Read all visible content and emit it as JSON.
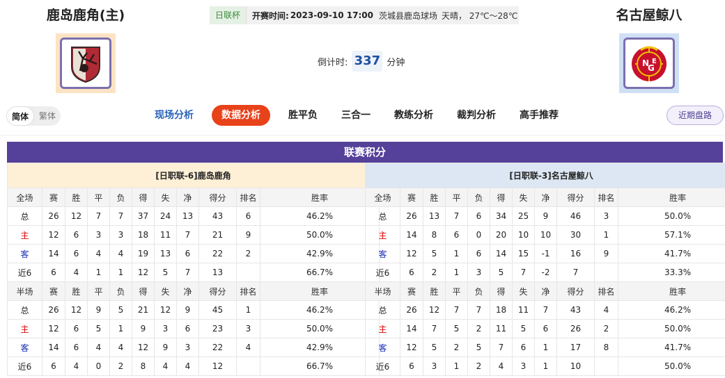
{
  "home": {
    "name": "鹿岛鹿角(主)",
    "logo_bg": "#fce3c4"
  },
  "away": {
    "name": "名古屋鲸八",
    "logo_bg": "#cfe0f5"
  },
  "match": {
    "league": "日联杯",
    "kickoff_label": "开赛时间:",
    "kickoff_time": "2023-09-10 17:00",
    "venue": "茨城县鹿岛球场",
    "weather": "天晴， 27℃～28℃"
  },
  "countdown": {
    "label": "倒计时:",
    "value": "337",
    "unit": "分钟"
  },
  "lang": {
    "simplified": "简体",
    "traditional": "繁体"
  },
  "nav": [
    "现场分析",
    "数据分析",
    "胜平负",
    "三合一",
    "教练分析",
    "裁判分析",
    "高手推荐"
  ],
  "recent_btn": "近期盘路",
  "standings": {
    "title": "联赛积分",
    "headers_full": [
      "全场",
      "赛",
      "胜",
      "平",
      "负",
      "得",
      "失",
      "净",
      "得分",
      "排名",
      "胜率"
    ],
    "headers_half": [
      "半场",
      "赛",
      "胜",
      "平",
      "负",
      "得",
      "失",
      "净",
      "得分",
      "排名",
      "胜率"
    ],
    "home": {
      "label": "[日职联-6]鹿岛鹿角",
      "full": [
        [
          "总",
          "26",
          "12",
          "7",
          "7",
          "37",
          "24",
          "13",
          "43",
          "6",
          "46.2%"
        ],
        [
          "主",
          "12",
          "6",
          "3",
          "3",
          "18",
          "11",
          "7",
          "21",
          "9",
          "50.0%"
        ],
        [
          "客",
          "14",
          "6",
          "4",
          "4",
          "19",
          "13",
          "6",
          "22",
          "2",
          "42.9%"
        ],
        [
          "近6",
          "6",
          "4",
          "1",
          "1",
          "12",
          "5",
          "7",
          "13",
          "",
          "66.7%"
        ]
      ],
      "half": [
        [
          "总",
          "26",
          "12",
          "9",
          "5",
          "21",
          "12",
          "9",
          "45",
          "1",
          "46.2%"
        ],
        [
          "主",
          "12",
          "6",
          "5",
          "1",
          "9",
          "3",
          "6",
          "23",
          "3",
          "50.0%"
        ],
        [
          "客",
          "14",
          "6",
          "4",
          "4",
          "12",
          "9",
          "3",
          "22",
          "4",
          "42.9%"
        ],
        [
          "近6",
          "6",
          "4",
          "0",
          "2",
          "8",
          "4",
          "4",
          "12",
          "",
          "66.7%"
        ]
      ]
    },
    "away": {
      "label": "[日职联-3]名古屋鲸八",
      "full": [
        [
          "总",
          "26",
          "13",
          "7",
          "6",
          "34",
          "25",
          "9",
          "46",
          "3",
          "50.0%"
        ],
        [
          "主",
          "14",
          "8",
          "6",
          "0",
          "20",
          "10",
          "10",
          "30",
          "1",
          "57.1%"
        ],
        [
          "客",
          "12",
          "5",
          "1",
          "6",
          "14",
          "15",
          "-1",
          "16",
          "9",
          "41.7%"
        ],
        [
          "近6",
          "6",
          "2",
          "1",
          "3",
          "5",
          "7",
          "-2",
          "7",
          "",
          "33.3%"
        ]
      ],
      "half": [
        [
          "总",
          "26",
          "12",
          "7",
          "7",
          "18",
          "11",
          "7",
          "43",
          "4",
          "46.2%"
        ],
        [
          "主",
          "14",
          "7",
          "5",
          "2",
          "11",
          "5",
          "6",
          "26",
          "2",
          "50.0%"
        ],
        [
          "客",
          "12",
          "5",
          "2",
          "5",
          "7",
          "6",
          "1",
          "17",
          "8",
          "41.7%"
        ],
        [
          "近6",
          "6",
          "3",
          "1",
          "2",
          "4",
          "3",
          "1",
          "10",
          "",
          "50.0%"
        ]
      ]
    }
  }
}
